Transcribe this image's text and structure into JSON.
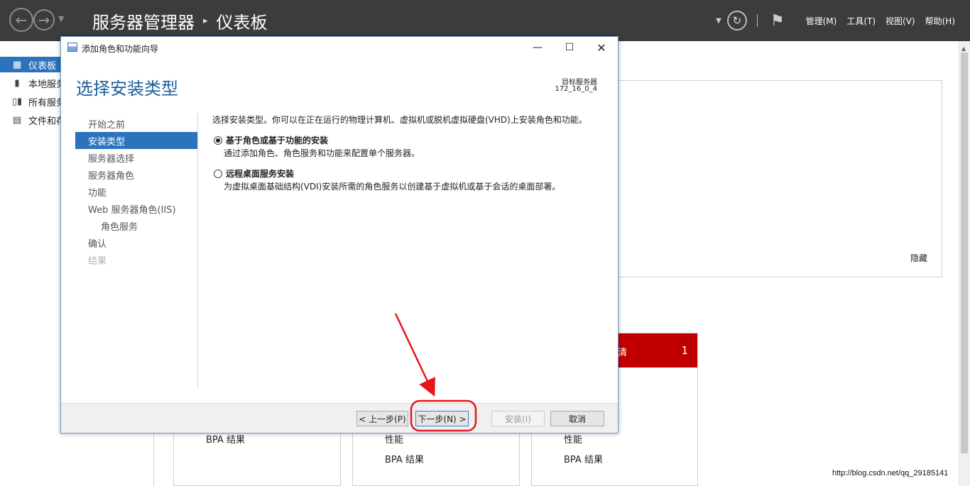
{
  "topbar": {
    "breadcrumb_app": "服务器管理器",
    "breadcrumb_sep": "▸",
    "breadcrumb_page": "仪表板",
    "menus": [
      "管理(M)",
      "工具(T)",
      "视图(V)",
      "帮助(H)"
    ]
  },
  "leftnav": {
    "items": [
      {
        "label": "仪表板",
        "icon": "dashboard-icon"
      },
      {
        "label": "本地服务",
        "icon": "server-icon"
      },
      {
        "label": "所有服务",
        "icon": "servers-icon"
      },
      {
        "label": "文件和存",
        "icon": "file-storage-icon"
      }
    ]
  },
  "dashboard": {
    "hide_link": "隐藏",
    "tile3_count": "1",
    "tile3_partial": "清",
    "tile1_bpa": "BPA 结果",
    "tile2_perf": "性能",
    "tile2_bpa": "BPA 结果",
    "tile3_perf": "性能",
    "tile3_bpa": "BPA 结果",
    "watermark": "http://blog.csdn.net/qq_29185141"
  },
  "dialog": {
    "title": "添加角色和功能向导",
    "header_title": "选择安装类型",
    "target_label": "目标服务器",
    "target_value": "172_16_0_4",
    "steps": [
      {
        "label": "开始之前",
        "state": "normal"
      },
      {
        "label": "安装类型",
        "state": "active"
      },
      {
        "label": "服务器选择",
        "state": "normal"
      },
      {
        "label": "服务器角色",
        "state": "normal"
      },
      {
        "label": "功能",
        "state": "normal"
      },
      {
        "label": "Web 服务器角色(IIS)",
        "state": "normal"
      },
      {
        "label": "角色服务",
        "state": "sub"
      },
      {
        "label": "确认",
        "state": "normal"
      },
      {
        "label": "结果",
        "state": "disabled"
      }
    ],
    "intro": "选择安装类型。你可以在正在运行的物理计算机、虚拟机或脱机虚拟硬盘(VHD)上安装角色和功能。",
    "options": [
      {
        "label": "基于角色或基于功能的安装",
        "desc": "通过添加角色、角色服务和功能来配置单个服务器。",
        "checked": true
      },
      {
        "label": "远程桌面服务安装",
        "desc": "为虚拟桌面基础结构(VDI)安装所需的角色服务以创建基于虚拟机或基于会话的桌面部署。",
        "checked": false
      }
    ],
    "buttons": {
      "prev": "< 上一步(P)",
      "next": "下一步(N) >",
      "install": "安装(I)",
      "cancel": "取消"
    }
  },
  "colors": {
    "accent": "#2b73bc",
    "header_title": "#1f5f9e",
    "alert_red": "#c00000",
    "annotation": "#e8141b"
  }
}
